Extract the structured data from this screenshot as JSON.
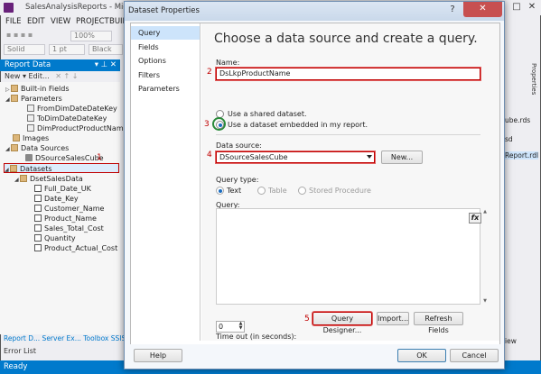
{
  "vs": {
    "title": "SalesAnalysisReports - Microsoft Vis",
    "menu": [
      "FILE",
      "EDIT",
      "VIEW",
      "PROJECT",
      "BUIL"
    ],
    "toolbar": {
      "line_style": "Solid",
      "line_width": "1 pt",
      "color": "Black",
      "zoom": "100%"
    },
    "report_data": {
      "header": "Report Data",
      "toolbar_label": "New ▾  Edit...",
      "tree": {
        "built_in": "Built-in Fields",
        "parameters": "Parameters",
        "params": [
          "FromDimDateDateKey",
          "ToDimDateDateKey",
          "DimProductProductName"
        ],
        "images": "Images",
        "data_sources": "Data Sources",
        "data_source_item": "DSourceSalesCube",
        "datasets": "Datasets",
        "dataset_item": "DsetSalesData",
        "fields": [
          "Full_Date_UK",
          "Date_Key",
          "Customer_Name",
          "Product_Name",
          "Sales_Total_Cost",
          "Quantity",
          "Product_Actual_Cost"
        ]
      }
    },
    "bottom_tabs": "Report D...  Server Ex...  Toolbox  SSIS Too",
    "error_list": "Error List",
    "status": "Ready",
    "right_pane": {
      "properties": "Properties",
      "item1": "ube.rds",
      "item2": "sd",
      "item3": "Report.rdl",
      "item4": "iew"
    }
  },
  "dialog": {
    "title": "Dataset Properties",
    "nav": [
      "Query",
      "Fields",
      "Options",
      "Filters",
      "Parameters"
    ],
    "heading": "Choose a data source and create a query.",
    "name_label": "Name:",
    "name_value": "DsLkpProductName",
    "radio_shared": "Use a shared dataset.",
    "radio_embedded": "Use a dataset embedded in my report.",
    "data_source_label": "Data source:",
    "data_source_value": "DSourceSalesCube",
    "new_button": "New...",
    "query_type_label": "Query type:",
    "query_types": [
      "Text",
      "Table",
      "Stored Procedure"
    ],
    "query_label": "Query:",
    "fx": "fx",
    "query_designer": "Query Designer...",
    "import": "Import...",
    "refresh_fields": "Refresh Fields",
    "timeout_label": "Time out (in seconds):",
    "timeout_value": "0",
    "help": "Help",
    "ok": "OK",
    "cancel": "Cancel",
    "help_glyph": "?",
    "close_glyph": "✕"
  },
  "annotations": [
    "1",
    "2",
    "3",
    "4",
    "5"
  ],
  "colors": {
    "accent": "#007acc",
    "annotation": "#c00000",
    "selected_nav": "#cde4fb",
    "close": "#c75050"
  }
}
